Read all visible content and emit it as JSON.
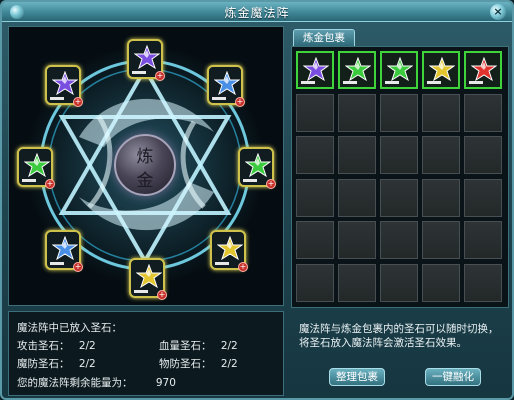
{
  "window": {
    "title": "炼金魔法阵",
    "close_label": "×"
  },
  "circle": {
    "center_chars": [
      "炼",
      "金"
    ],
    "slots": [
      {
        "color": "purple"
      },
      {
        "color": "blue"
      },
      {
        "color": "green"
      },
      {
        "color": "yellow"
      },
      {
        "color": "yellow"
      },
      {
        "color": "blue"
      },
      {
        "color": "green"
      },
      {
        "color": "purple"
      }
    ]
  },
  "info": {
    "heading": "魔法阵中已放入圣石：",
    "attack_label": "攻击圣石：",
    "attack_value": "2/2",
    "hp_label": "血量圣石：",
    "hp_value": "2/2",
    "mdef_label": "魔防圣石：",
    "mdef_value": "2/2",
    "pdef_label": "物防圣石：",
    "pdef_value": "2/2",
    "energy_label": "您的魔法阵剩余能量为：",
    "energy_value": "970"
  },
  "bag": {
    "tab_label": "炼金包裹",
    "rows": 6,
    "cols": 5,
    "items": [
      {
        "color": "purple"
      },
      {
        "color": "green"
      },
      {
        "color": "green"
      },
      {
        "color": "yellow"
      },
      {
        "color": "red"
      }
    ]
  },
  "description": "魔法阵与炼金包裹内的圣石可以随时切换，将圣石放入魔法阵会激活圣石效果。",
  "buttons": {
    "sort_label": "整理包裹",
    "fuse_label": "一键融化"
  },
  "gem_colors": {
    "purple": "#7a4ee0",
    "blue": "#4a8fe6",
    "green": "#3ccb3e",
    "yellow": "#e2c630",
    "red": "#e0332e"
  }
}
